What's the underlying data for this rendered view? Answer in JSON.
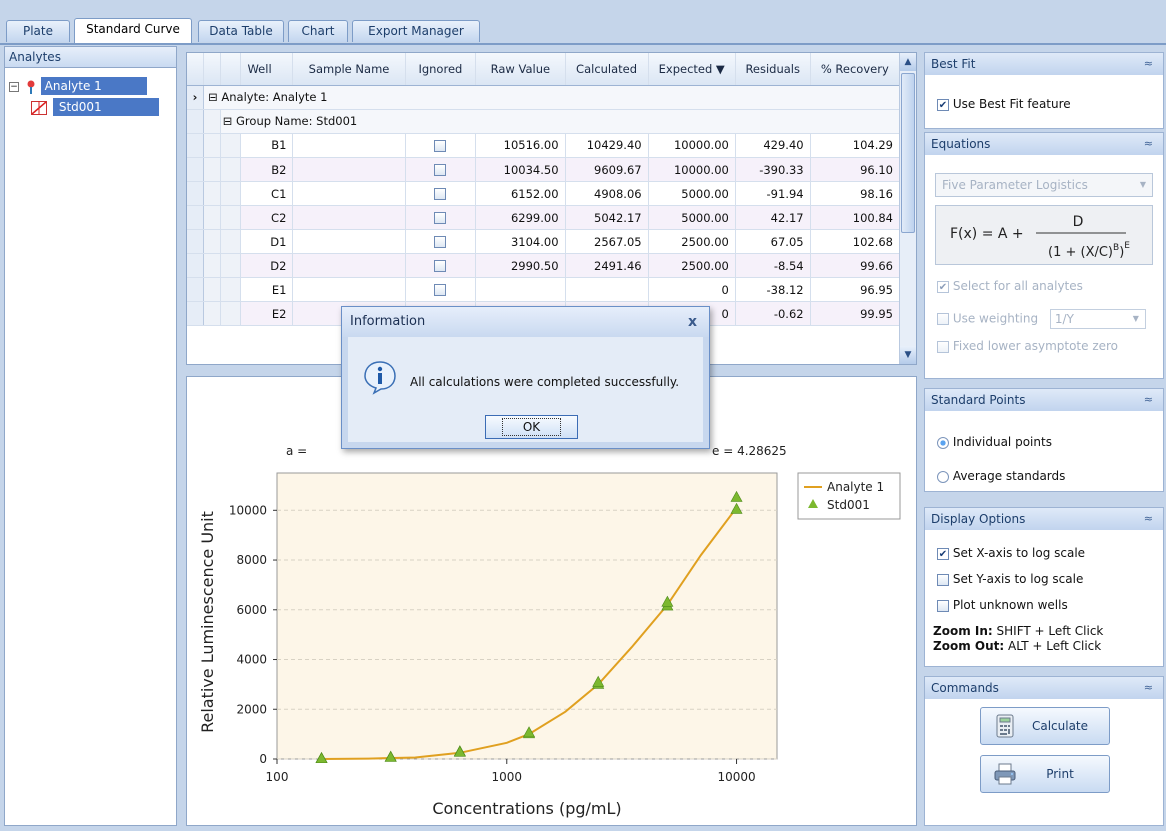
{
  "tabs": [
    {
      "label": "Plate"
    },
    {
      "label": "Standard Curve"
    },
    {
      "label": "Data Table"
    },
    {
      "label": "Chart"
    },
    {
      "label": "Export Manager"
    }
  ],
  "analytes": {
    "header": "Analytes",
    "tree": [
      {
        "label": "Analyte 1"
      },
      {
        "label": "Std001"
      }
    ]
  },
  "grid": {
    "columns": [
      "Well",
      "Sample Name",
      "Ignored",
      "Raw Value",
      "Calculated",
      "Expected ▼",
      "Residuals",
      "% Recovery"
    ],
    "group1": "Analyte: Analyte 1",
    "group2": "Group Name: Std001",
    "rows": [
      {
        "well": "B1",
        "raw": "10516.00",
        "calc": "10429.40",
        "exp": "10000.00",
        "res": "429.40",
        "rec": "104.29"
      },
      {
        "well": "B2",
        "raw": "10034.50",
        "calc": "9609.67",
        "exp": "10000.00",
        "res": "-390.33",
        "rec": "96.10"
      },
      {
        "well": "C1",
        "raw": "6152.00",
        "calc": "4908.06",
        "exp": "5000.00",
        "res": "-91.94",
        "rec": "98.16"
      },
      {
        "well": "C2",
        "raw": "6299.00",
        "calc": "5042.17",
        "exp": "5000.00",
        "res": "42.17",
        "rec": "100.84"
      },
      {
        "well": "D1",
        "raw": "3104.00",
        "calc": "2567.05",
        "exp": "2500.00",
        "res": "67.05",
        "rec": "102.68"
      },
      {
        "well": "D2",
        "raw": "2990.50",
        "calc": "2491.46",
        "exp": "2500.00",
        "res": "-8.54",
        "rec": "99.66"
      },
      {
        "well": "E1",
        "raw": "",
        "calc": "",
        "exp": "0",
        "res": "-38.12",
        "rec": "96.95"
      },
      {
        "well": "E2",
        "raw": "",
        "calc": "",
        "exp": "0",
        "res": "-0.62",
        "rec": "99.95"
      }
    ]
  },
  "dialog": {
    "title": "Information",
    "message": "All calculations were completed successfully.",
    "ok": "OK",
    "close": "x"
  },
  "chart_text": {
    "param_a": "a =",
    "param_e": "e = 4.28625"
  },
  "chart_data": {
    "type": "line",
    "xlabel": "Concentrations (pg/mL)",
    "ylabel": "Relative Luminescence Unit",
    "x_scale": "log",
    "xlim": [
      100,
      15000
    ],
    "ylim": [
      0,
      11500
    ],
    "x_ticks": [
      100,
      1000,
      10000
    ],
    "x_tick_labels": [
      "100",
      "1000",
      "10000"
    ],
    "y_ticks": [
      0,
      2000,
      4000,
      6000,
      8000,
      10000
    ],
    "y_tick_labels": [
      "0",
      "2000",
      "4000",
      "6000",
      "8000",
      "10000"
    ],
    "grid": true,
    "legend_position": "top-right",
    "series": [
      {
        "name": "Analyte 1",
        "type": "line",
        "color": "#e0a020",
        "x": [
          156.25,
          250,
          400,
          625,
          1000,
          1250,
          1800,
          2500,
          3500,
          5000,
          7000,
          10000
        ],
        "y": [
          0,
          15,
          60,
          250,
          650,
          1000,
          1900,
          3000,
          4500,
          6200,
          8200,
          10100
        ]
      },
      {
        "name": "Std001",
        "type": "scatter",
        "color": "#7cb82f",
        "x": [
          156.25,
          156.25,
          312.5,
          312.5,
          625,
          625,
          1250,
          1250,
          2500,
          2500,
          5000,
          5000,
          10000,
          10000
        ],
        "y": [
          20,
          10,
          70,
          60,
          290,
          270,
          1010,
          1050,
          3000,
          3080,
          6150,
          6300,
          10034.5,
          10516
        ]
      }
    ]
  },
  "right": {
    "best_fit": {
      "title": "Best Fit",
      "use_label": "Use Best Fit feature"
    },
    "equations": {
      "title": "Equations",
      "model": "Five Parameter Logistics",
      "formula_lhs": "F(x) = A +",
      "formula_num": "D",
      "select_all": "Select for all analytes",
      "use_weighting": "Use weighting",
      "weighting_value": "1/Y",
      "fixed_lower": "Fixed lower asymptote zero"
    },
    "standard_points": {
      "title": "Standard Points",
      "individual": "Individual points",
      "average": "Average standards"
    },
    "display": {
      "title": "Display Options",
      "x_log": "Set X-axis to log scale",
      "y_log": "Set Y-axis to log scale",
      "plot_unknown": "Plot unknown wells",
      "zoom_in_label": "Zoom In:",
      "zoom_in_text": "SHIFT + Left Click",
      "zoom_out_label": "Zoom Out:",
      "zoom_out_text": "ALT + Left Click"
    },
    "commands": {
      "title": "Commands",
      "calculate": "Calculate",
      "print": "Print"
    }
  },
  "colors": {
    "accent": "#c5d5ea",
    "curve": "#e0a020",
    "marker": "#7cb82f",
    "plot_bg": "#fdf6e8"
  }
}
